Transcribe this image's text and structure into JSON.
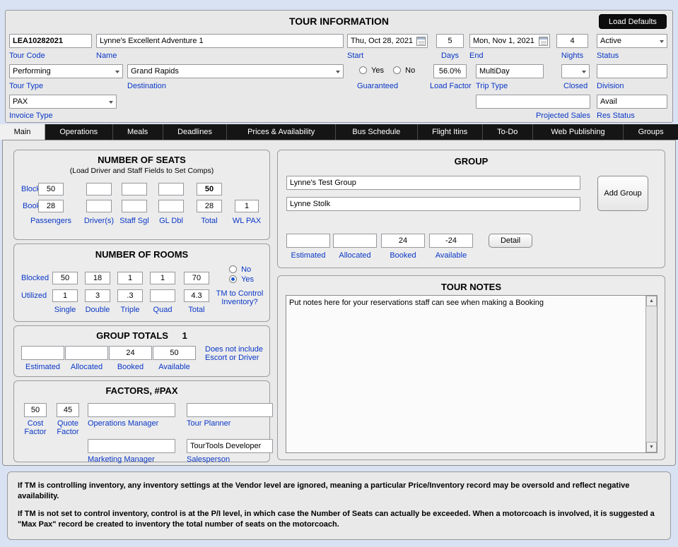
{
  "tour_info": {
    "title": "TOUR INFORMATION",
    "load_defaults_button": "Load Defaults",
    "tour_code": {
      "label": "Tour Code",
      "value": "LEA10282021"
    },
    "name": {
      "label": "Name",
      "value": "Lynne's Excellent Adventure 1"
    },
    "start": {
      "label": "Start",
      "value": "Thu, Oct 28, 2021"
    },
    "days": {
      "label": "Days",
      "value": "5"
    },
    "end": {
      "label": "End",
      "value": "Mon, Nov 1, 2021"
    },
    "nights": {
      "label": "Nights",
      "value": "4"
    },
    "status": {
      "label": "Status",
      "value": "Active"
    },
    "tour_type": {
      "label": "Tour Type",
      "value": "Performing"
    },
    "destination": {
      "label": "Destination",
      "value": "Grand Rapids"
    },
    "guaranteed": {
      "label": "Guaranteed",
      "yes_label": "Yes",
      "no_label": "No"
    },
    "load_factor": {
      "label": "Load Factor",
      "value": "56.0%"
    },
    "trip_type": {
      "label": "Trip Type",
      "value": "MultiDay"
    },
    "closed": {
      "label": "Closed",
      "value": ""
    },
    "division": {
      "label": "Division",
      "value": ""
    },
    "invoice_type": {
      "label": "Invoice Type",
      "value": "PAX"
    },
    "projected_sales": {
      "label": "Projected Sales",
      "value": ""
    },
    "res_status": {
      "label": "Res Status",
      "value": "Avail"
    }
  },
  "tabs": [
    "Main",
    "Operations",
    "Meals",
    "Deadlines",
    "Prices & Availability",
    "Bus Schedule",
    "Flight Itins",
    "To-Do",
    "Web Publishing",
    "Groups"
  ],
  "seats": {
    "title": "NUMBER OF SEATS",
    "subtitle": "(Load Driver and Staff Fields to Set Comps)",
    "blocked_label": "Blocked",
    "booked_label": "Booked",
    "blocked": {
      "passengers": "50",
      "drivers": "",
      "staff_sgl": "",
      "gl_dbl": "",
      "total": "50"
    },
    "booked": {
      "passengers": "28",
      "drivers": "",
      "staff_sgl": "",
      "gl_dbl": "",
      "total": "28",
      "wl_pax": "1"
    },
    "columns": [
      "Passengers",
      "Driver(s)",
      "Staff Sgl",
      "GL Dbl",
      "Total",
      "WL PAX"
    ]
  },
  "rooms": {
    "title": "NUMBER OF ROOMS",
    "blocked_label": "Blocked",
    "utilized_label": "Utilized",
    "blocked": {
      "single": "50",
      "double": "18",
      "triple": "1",
      "quad": "1",
      "total": "70"
    },
    "utilized": {
      "single": "1",
      "double": "3",
      "triple": ".3",
      "quad": "",
      "total": "4.3"
    },
    "columns": [
      "Single",
      "Double",
      "Triple",
      "Quad",
      "Total"
    ],
    "tm_control": {
      "no_label": "No",
      "yes_label": "Yes",
      "question": "TM to Control Inventory?"
    }
  },
  "group_totals": {
    "title": "GROUP TOTALS",
    "count": "1",
    "estimated": {
      "label": "Estimated",
      "value": ""
    },
    "allocated": {
      "label": "Allocated",
      "value": ""
    },
    "booked": {
      "label": "Booked",
      "value": "24"
    },
    "available": {
      "label": "Available",
      "value": "50"
    },
    "note": "Does not include Escort or Driver"
  },
  "factors": {
    "title": "FACTORS, #PAX",
    "cost_factor": {
      "label": "Cost Factor",
      "value": "50"
    },
    "quote_factor": {
      "label": "Quote Factor",
      "value": "45"
    },
    "operations_manager": {
      "label": "Operations Manager",
      "value": ""
    },
    "tour_planner": {
      "label": "Tour Planner",
      "value": ""
    },
    "marketing_manager": {
      "label": "Marketing Manager",
      "value": ""
    },
    "salesperson": {
      "label": "Salesperson",
      "value": "TourTools Developer"
    }
  },
  "group": {
    "title": "GROUP",
    "group_name": "Lynne's Test Group",
    "contact_name": "Lynne Stolk",
    "add_group_button": "Add Group",
    "estimated": {
      "label": "Estimated",
      "value": ""
    },
    "allocated": {
      "label": "Allocated",
      "value": ""
    },
    "booked": {
      "label": "Booked",
      "value": "24"
    },
    "available": {
      "label": "Available",
      "value": "-24"
    },
    "detail_button": "Detail"
  },
  "tour_notes": {
    "title": "TOUR NOTES",
    "text": "Put notes here for your reservations staff can see when making a Booking"
  },
  "footer": {
    "paragraph1": "If TM is controlling inventory, any inventory settings at the Vendor level are ignored, meaning a particular Price/Inventory record may be oversold and reflect negative availability.",
    "paragraph2": "If TM is not set to control inventory, control is at the P/I level, in which case the Number of Seats can actually be exceeded.  When a motorcoach is involved, it is suggested a \"Max Pax\" record be created to inventory the total number of seats on the motorcoach."
  }
}
